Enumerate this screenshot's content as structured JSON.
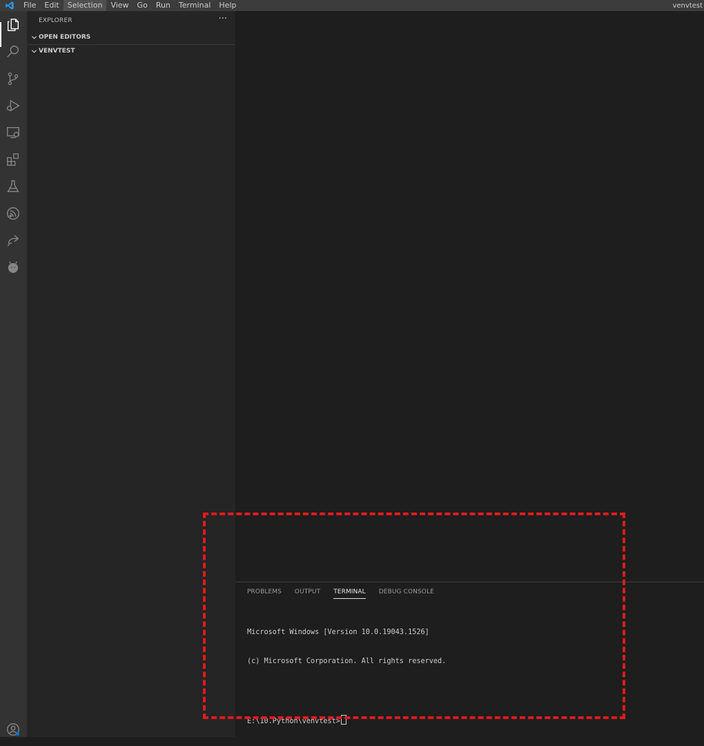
{
  "menubar": {
    "items": [
      "File",
      "Edit",
      "Selection",
      "View",
      "Go",
      "Run",
      "Terminal",
      "Help"
    ],
    "active_item": "Selection",
    "window_title": "venvtest"
  },
  "activitybar": {
    "icons": [
      "explorer-icon",
      "search-icon",
      "source-control-icon",
      "run-debug-icon",
      "remote-explorer-icon",
      "extensions-icon",
      "testing-icon",
      "espressif-icon",
      "live-share-icon",
      "platformio-icon"
    ],
    "bottom_icons": [
      "accounts-icon"
    ]
  },
  "sidebar": {
    "title": "EXPLORER",
    "more": "···",
    "sections": [
      {
        "label": "OPEN EDITORS",
        "expanded": true
      },
      {
        "label": "VENVTEST",
        "expanded": true
      }
    ]
  },
  "panel": {
    "tabs": [
      "PROBLEMS",
      "OUTPUT",
      "TERMINAL",
      "DEBUG CONSOLE"
    ],
    "active_tab": "TERMINAL",
    "terminal": {
      "lines": [
        "Microsoft Windows [Version 10.0.19043.1526]",
        "(c) Microsoft Corporation. All rights reserved.",
        "",
        "E:\\10.Python\\venvtest>"
      ]
    }
  },
  "colors": {
    "annotation": "#e21b1b",
    "activity_bar": "#333333",
    "sidebar": "#252526",
    "editor": "#1e1e1e",
    "menubar": "#3c3c3c"
  }
}
